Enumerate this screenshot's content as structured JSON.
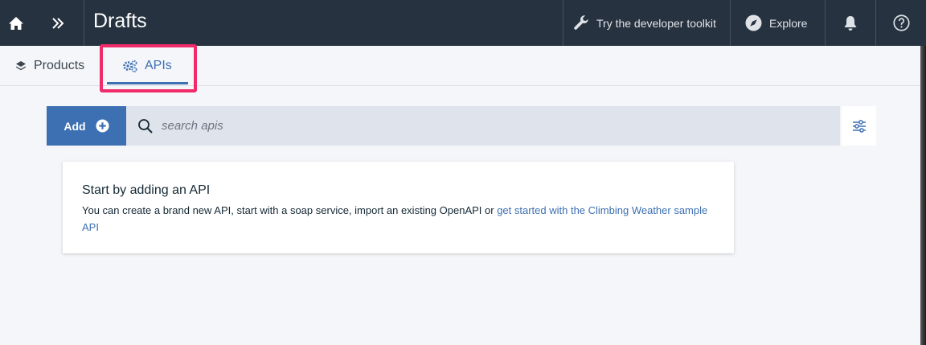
{
  "header": {
    "title": "Drafts",
    "toolkit_label": "Try the developer toolkit",
    "explore_label": "Explore"
  },
  "tabs": [
    {
      "label": "Products"
    },
    {
      "label": "APIs"
    }
  ],
  "toolbar": {
    "add_label": "Add",
    "search_placeholder": "search apis"
  },
  "empty_state": {
    "title": "Start by adding an API",
    "text": "You can create a brand new API, start with a soap service, import an existing OpenAPI or ",
    "link_text": "get started with the Climbing Weather sample API"
  },
  "colors": {
    "header_bg": "#26323f",
    "accent": "#3d70b2",
    "highlight": "#ef2b6a"
  }
}
